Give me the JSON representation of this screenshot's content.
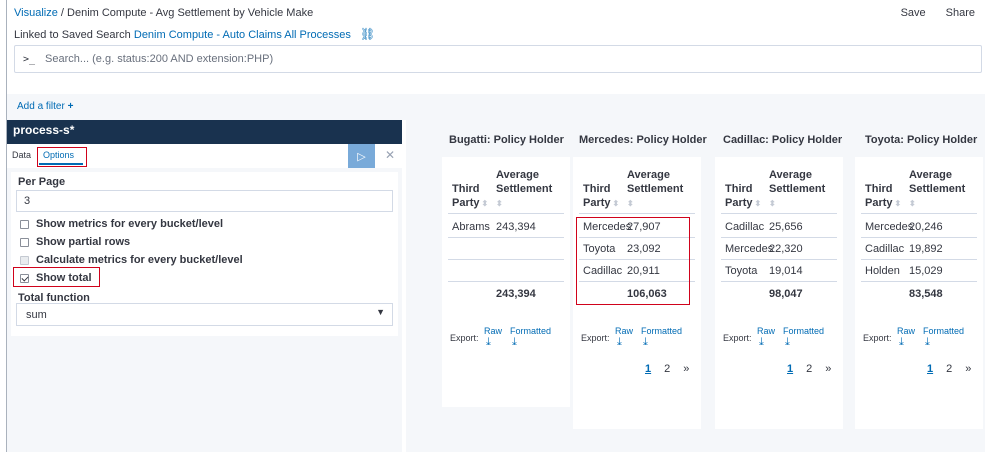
{
  "breadcrumb": {
    "root": "Visualize",
    "separator": "/",
    "title": "Denim Compute - Avg Settlement by Vehicle Make"
  },
  "top_actions": {
    "save": "Save",
    "share": "Share"
  },
  "linked": {
    "prefix": "Linked to Saved Search",
    "search_name": "Denim Compute - Auto Claims All Processes",
    "unlink_icon": "unlink-icon"
  },
  "search": {
    "prompt": ">_",
    "placeholder": "Search... (e.g. status:200 AND extension:PHP)",
    "value": ""
  },
  "filter": {
    "add_label": "Add a filter",
    "plus": "+"
  },
  "sidebar": {
    "index_pattern": "process-s*",
    "tabs": [
      "Data",
      "Options"
    ],
    "active_tab": "Options",
    "run_icon": "▷",
    "discard_icon": "✕",
    "per_page_label": "Per Page",
    "per_page_value": "3",
    "checkboxes": [
      {
        "label": "Show metrics for every bucket/level",
        "checked": false
      },
      {
        "label": "Show partial rows",
        "checked": false
      },
      {
        "label": "Calculate metrics for every bucket/level",
        "checked": false,
        "disabled": true
      },
      {
        "label": "Show total",
        "checked": true
      }
    ],
    "total_function_label": "Total function",
    "total_function_value": "sum",
    "select_caret": "▼",
    "collapse_icon": "◀",
    "resize_handle": "⋮"
  },
  "tables": [
    {
      "title": "Bugatti: Policy Holder",
      "col1": [
        "Third",
        "Party"
      ],
      "col2": [
        "Average",
        "Settlement"
      ],
      "rows": [
        [
          "Abrams",
          "243,394"
        ]
      ],
      "total": "243,394",
      "pagination": false
    },
    {
      "title": "Mercedes: Policy Holder",
      "col1": [
        "Third",
        "Party"
      ],
      "col2": [
        "Average",
        "Settlement"
      ],
      "rows": [
        [
          "Mercedes",
          "27,907"
        ],
        [
          "Toyota",
          "23,092"
        ],
        [
          "Cadillac",
          "20,911"
        ]
      ],
      "total": "106,063",
      "pagination": true
    },
    {
      "title": "Cadillac: Policy Holder",
      "col1": [
        "Third",
        "Party"
      ],
      "col2": [
        "Average",
        "Settlement"
      ],
      "rows": [
        [
          "Cadillac",
          "25,656"
        ],
        [
          "Mercedes",
          "22,320"
        ],
        [
          "Toyota",
          "19,014"
        ]
      ],
      "total": "98,047",
      "pagination": true
    },
    {
      "title": "Toyota: Policy Holder",
      "col1": [
        "Third",
        "Party"
      ],
      "col2": [
        "Average",
        "Settlement"
      ],
      "rows": [
        [
          "Mercedes",
          "20,246"
        ],
        [
          "Cadillac",
          "19,892"
        ],
        [
          "Holden",
          "15,029"
        ]
      ],
      "total": "83,548",
      "pagination": true
    }
  ],
  "export": {
    "label": "Export:",
    "raw": "Raw",
    "formatted": "Formatted",
    "download_icon": "⤓"
  },
  "pagination": {
    "pages": [
      "1",
      "2"
    ],
    "next": "»"
  }
}
